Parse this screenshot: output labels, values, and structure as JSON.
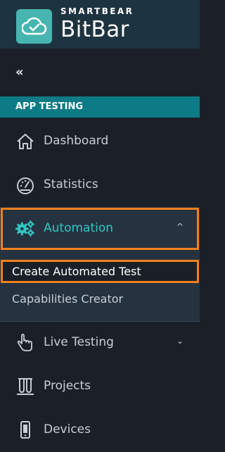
{
  "brand": {
    "small": "SMARTBEAR",
    "big": "BitBar",
    "logo_icon": "cloud-check-icon"
  },
  "colors": {
    "sidebar_bg": "#1b2028",
    "brand_bg": "#1e3340",
    "section_header_bg": "#0d7b86",
    "accent": "#33c6c3",
    "highlight": "#f2801e",
    "submenu_bg": "#253240"
  },
  "collapse_glyph": "«",
  "section_header": "APP TESTING",
  "nav": {
    "dashboard": {
      "label": "Dashboard",
      "icon": "home-icon"
    },
    "statistics": {
      "label": "Statistics",
      "icon": "gauge-icon"
    },
    "automation": {
      "label": "Automation",
      "icon": "gears-icon",
      "chevron": "^",
      "expanded": true
    },
    "live_testing": {
      "label": "Live Testing",
      "icon": "hand-pointer-icon",
      "chevron": "⌄"
    },
    "projects": {
      "label": "Projects",
      "icon": "test-tubes-icon"
    },
    "devices": {
      "label": "Devices",
      "icon": "mobile-device-icon"
    }
  },
  "automation_submenu": [
    {
      "label": "Create Automated Test",
      "highlighted": true
    },
    {
      "label": "Capabilities Creator"
    }
  ]
}
